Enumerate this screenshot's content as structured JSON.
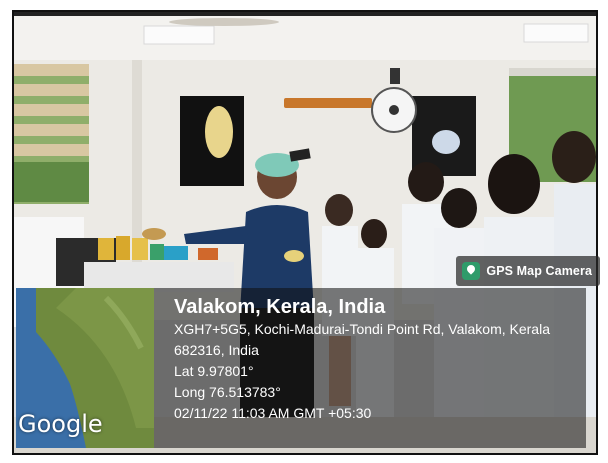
{
  "gps_stamp": {
    "app_name": "GPS Map Camera",
    "location_title": "Valakom, Kerala, India",
    "address_line_1": "XGH7+5G5, Kochi-Madurai-Tondi Point Rd, Valakom, Kerala",
    "address_line_2": "682316, India",
    "latitude": "Lat 9.97801°",
    "longitude": "Long 76.513783°",
    "datetime": "02/11/22 11:03 AM GMT +05:30",
    "map_provider": "Google"
  },
  "colors": {
    "wall": "#eceae5",
    "ceiling": "#f3f2ef",
    "lab_coat": "#f2f4f6",
    "presenter_top": "#1d3a66",
    "app_icon": "#2f9b6a"
  }
}
